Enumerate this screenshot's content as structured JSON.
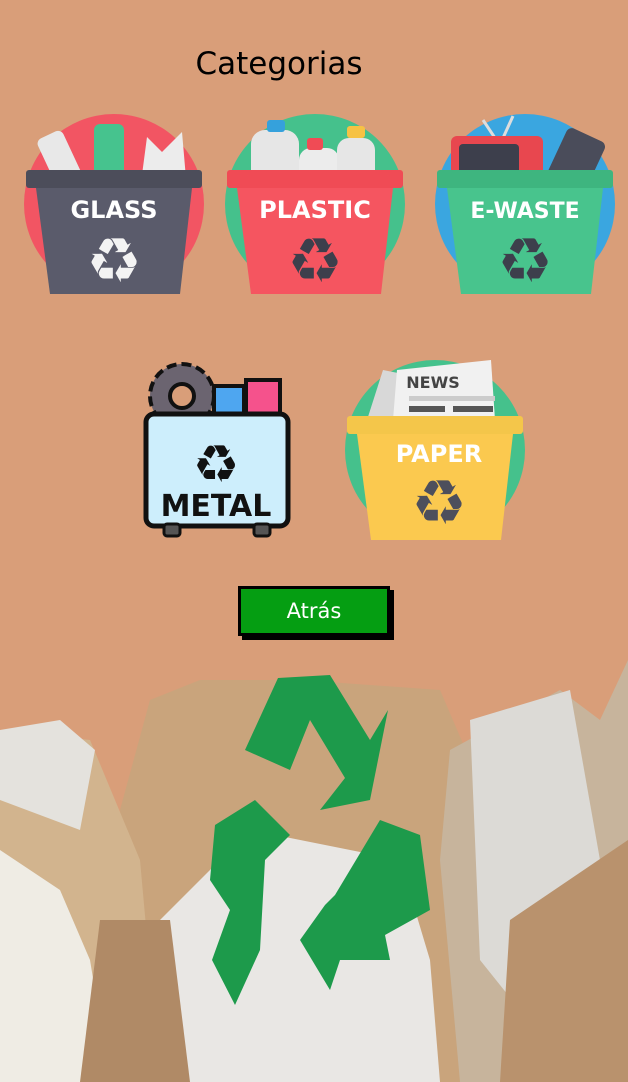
{
  "header": {
    "title": "Categorias"
  },
  "categories": [
    {
      "label": "GLASS",
      "bg": "#f25563",
      "bin": "#565766"
    },
    {
      "label": "PLASTIC",
      "bg": "#45c18c",
      "bin": "#f04b55"
    },
    {
      "label": "E-WASTE",
      "bg": "#3aa6e0",
      "bin": "#48c48d"
    },
    {
      "label": "METAL",
      "bin": "#cdeefc"
    },
    {
      "label": "PAPER",
      "sublabel": "NEWS",
      "bg": "#45c18c",
      "bin": "#fbc94f"
    }
  ],
  "buttons": {
    "back": "Atrás"
  },
  "colors": {
    "background": "#d99e79",
    "button": "#059e12",
    "recycle": "#1d9a4b"
  }
}
